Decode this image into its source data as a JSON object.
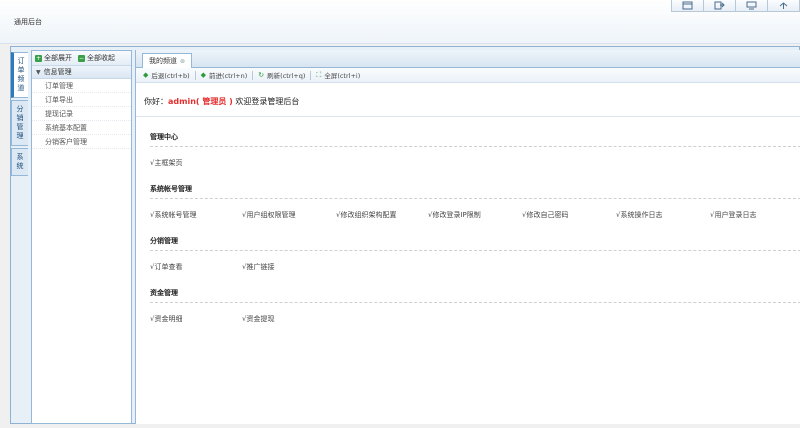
{
  "header": {
    "app_title": "通用后台",
    "icons": [
      "window-icon",
      "export-icon",
      "monitor-icon",
      "fullscreen-icon"
    ]
  },
  "vtabs": [
    {
      "label": [
        "订",
        "单",
        "频",
        "道"
      ],
      "active": true
    },
    {
      "label": [
        "分",
        "销",
        "管",
        "理"
      ],
      "active": false
    },
    {
      "label": [
        "系",
        "统"
      ],
      "active": false
    }
  ],
  "menu": {
    "expand_all": "全部展开",
    "collapse_all": "全部收起",
    "group_title": "信息管理",
    "items": [
      "订单管理",
      "订单导出",
      "提现记录",
      "系统基本配置",
      "分销客户管理"
    ]
  },
  "main": {
    "tab_label": "我的频道",
    "nav": {
      "back": "后退(ctrl+b)",
      "forward": "前进(ctrl+n)",
      "refresh": "刷新(ctrl+q)",
      "fullscreen": "全屏(ctrl+i)"
    },
    "welcome_prefix": "你好：",
    "welcome_user": "admin( 管理员 )",
    "welcome_suffix": " 欢迎登录管理后台",
    "sections": [
      {
        "title": "管理中心",
        "links": [
          "√主框架页"
        ]
      },
      {
        "title": "系统帐号管理",
        "links": [
          "√系统帐号管理",
          "√用户组权限管理",
          "√修改组织架构配置",
          "√修改登录IP限制",
          "√修改自己密码",
          "√系统操作日志",
          "√用户登录日志"
        ]
      },
      {
        "title": "分销管理",
        "links": [
          "√订单查看",
          "√推广链接"
        ]
      },
      {
        "title": "资金管理",
        "links": [
          "√资金明细",
          "√资金提现"
        ]
      }
    ]
  },
  "colors": {
    "accent": "#2f7ab8",
    "border": "#95b8d8",
    "highlight": "#e52d2d",
    "icon_green": "#3aa048"
  }
}
